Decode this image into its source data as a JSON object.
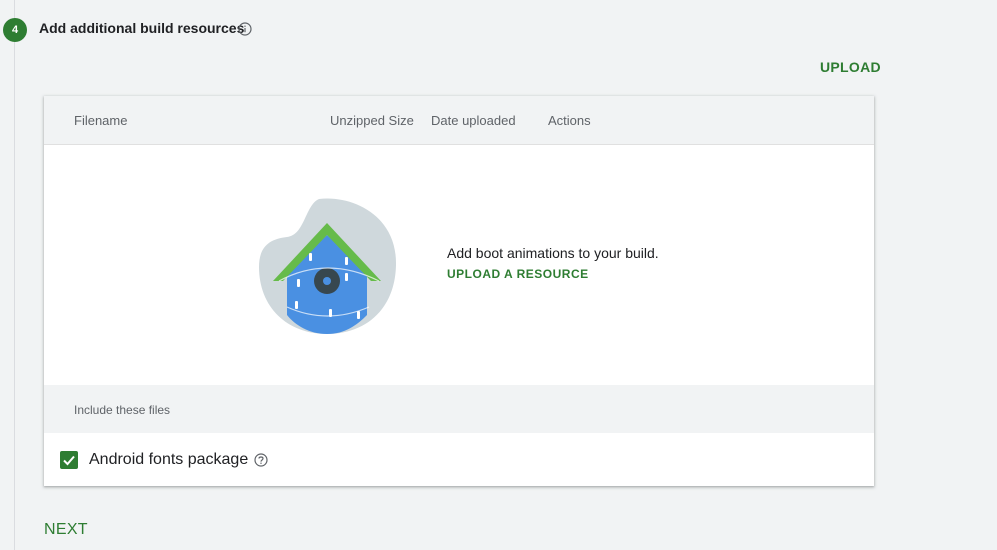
{
  "step": {
    "number": "4",
    "title": "Add additional build resources",
    "info_icon": "info-icon"
  },
  "upload_button": "UPLOAD",
  "table": {
    "columns": [
      "Filename",
      "Unzipped Size",
      "Date uploaded",
      "Actions"
    ]
  },
  "empty_state": {
    "illustration": "birdhouse-illustration",
    "message": "Add boot animations to your build.",
    "link": "UPLOAD A RESOURCE"
  },
  "include_section": {
    "header": "Include these files",
    "items": [
      {
        "label": "Android fonts package",
        "checked": true,
        "help_icon": "help-icon"
      }
    ]
  },
  "next_button": "NEXT",
  "colors": {
    "accent": "#2e7d32",
    "background": "#f1f3f4",
    "card": "#ffffff"
  }
}
